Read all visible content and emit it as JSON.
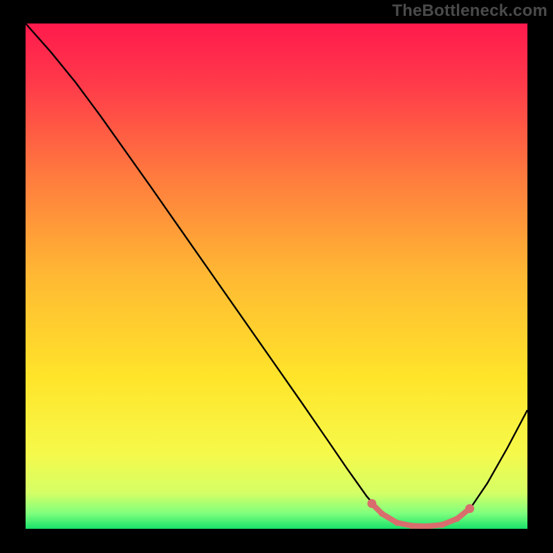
{
  "watermark": "TheBottleneck.com",
  "chart_data": {
    "type": "line",
    "title": "",
    "xlabel": "",
    "ylabel": "",
    "xlim": [
      0,
      1
    ],
    "ylim": [
      0,
      1
    ],
    "background": {
      "kind": "vertical-gradient",
      "stops": [
        {
          "pos": 0.0,
          "color": "#ff1a4d"
        },
        {
          "pos": 0.12,
          "color": "#ff3a4a"
        },
        {
          "pos": 0.3,
          "color": "#ff7a3e"
        },
        {
          "pos": 0.5,
          "color": "#ffb933"
        },
        {
          "pos": 0.7,
          "color": "#ffe42a"
        },
        {
          "pos": 0.85,
          "color": "#f6f94a"
        },
        {
          "pos": 0.93,
          "color": "#d4ff66"
        },
        {
          "pos": 0.97,
          "color": "#7dff7d"
        },
        {
          "pos": 1.0,
          "color": "#18e06a"
        }
      ]
    },
    "series": [
      {
        "name": "curve",
        "stroke": "#000000",
        "points": [
          {
            "x": 0.0,
            "y": 1.0
          },
          {
            "x": 0.05,
            "y": 0.944
          },
          {
            "x": 0.1,
            "y": 0.883
          },
          {
            "x": 0.15,
            "y": 0.816
          },
          {
            "x": 0.2,
            "y": 0.746
          },
          {
            "x": 0.25,
            "y": 0.676
          },
          {
            "x": 0.3,
            "y": 0.605
          },
          {
            "x": 0.35,
            "y": 0.534
          },
          {
            "x": 0.4,
            "y": 0.463
          },
          {
            "x": 0.45,
            "y": 0.392
          },
          {
            "x": 0.5,
            "y": 0.321
          },
          {
            "x": 0.55,
            "y": 0.25
          },
          {
            "x": 0.6,
            "y": 0.178
          },
          {
            "x": 0.64,
            "y": 0.12
          },
          {
            "x": 0.68,
            "y": 0.064
          },
          {
            "x": 0.71,
            "y": 0.03
          },
          {
            "x": 0.74,
            "y": 0.012
          },
          {
            "x": 0.77,
            "y": 0.006
          },
          {
            "x": 0.8,
            "y": 0.005
          },
          {
            "x": 0.83,
            "y": 0.008
          },
          {
            "x": 0.86,
            "y": 0.02
          },
          {
            "x": 0.89,
            "y": 0.046
          },
          {
            "x": 0.92,
            "y": 0.09
          },
          {
            "x": 0.96,
            "y": 0.16
          },
          {
            "x": 1.0,
            "y": 0.235
          }
        ]
      }
    ],
    "highlight": {
      "stroke": "#d96d6d",
      "xrange": [
        0.69,
        0.885
      ],
      "points": [
        {
          "x": 0.69,
          "y": 0.05
        },
        {
          "x": 0.71,
          "y": 0.03
        },
        {
          "x": 0.74,
          "y": 0.012
        },
        {
          "x": 0.77,
          "y": 0.006
        },
        {
          "x": 0.8,
          "y": 0.005
        },
        {
          "x": 0.83,
          "y": 0.008
        },
        {
          "x": 0.86,
          "y": 0.02
        },
        {
          "x": 0.885,
          "y": 0.04
        }
      ]
    }
  }
}
